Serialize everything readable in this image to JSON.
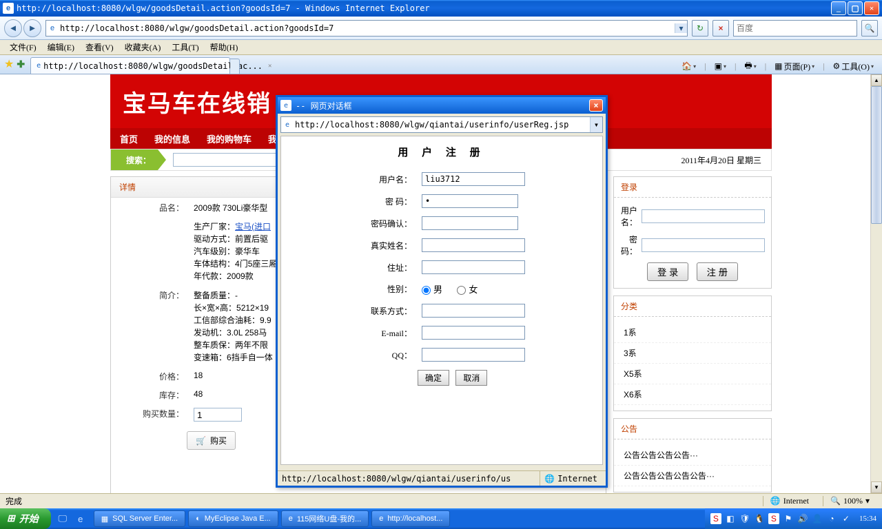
{
  "titlebar": {
    "text": "http://localhost:8080/wlgw/goodsDetail.action?goodsId=7 - Windows Internet Explorer"
  },
  "address": "http://localhost:8080/wlgw/goodsDetail.action?goodsId=7",
  "search_placeholder": "百度",
  "menu": {
    "file": "文件(F)",
    "edit": "编辑(E)",
    "view": "查看(V)",
    "fav": "收藏夹(A)",
    "tools": "工具(T)",
    "help": "帮助(H)"
  },
  "tab_title": "http://localhost:8080/wlgw/goodsDetail.ac...",
  "cmdbar": {
    "page": "页面(P)",
    "tools": "工具(O)"
  },
  "site": {
    "banner": "宝马车在线销",
    "nav": {
      "home": "首页",
      "info": "我的信息",
      "cart": "我的购物车",
      "mine": "我的"
    },
    "search_label": "搜索：",
    "date": "2011年4月20日 星期三",
    "detail_hdr": "详情",
    "labels": {
      "name": "品名：",
      "intro": "简介：",
      "price": "价格：",
      "stock": "库存：",
      "qty": "购买数量："
    },
    "name_value": "2009款 730Li豪华型",
    "spec": {
      "mfr_lbl": "生产厂家：",
      "mfr_val": "宝马(进口",
      "drive_lbl": "驱动方式：",
      "drive_val": "前置后驱",
      "class_lbl": "汽车级别：",
      "class_val": "豪华车",
      "body_lbl": "车体结构：",
      "body_val": "4门5座三厢",
      "year_lbl": "年代款：",
      "year_val": "2009款",
      "mass_lbl": "整备质量：",
      "mass_val": "-",
      "dim_lbl": "长×宽×高：",
      "dim_val": "5212×19",
      "fuel_lbl": "工信部综合油耗：",
      "fuel_val": "9.9",
      "engine_lbl": "发动机：",
      "engine_val": "3.0L 258马",
      "warranty_lbl": "整车质保：",
      "warranty_val": "两年不限",
      "gearbox_lbl": "变速箱：",
      "gearbox_val": "6挡手自一体"
    },
    "price": "18",
    "stock": "48",
    "qty": "1",
    "buy": "购买",
    "login": {
      "hdr": "登录",
      "user": "用户名：",
      "pass": "密  码：",
      "login_btn": "登 录",
      "reg_btn": "注 册"
    },
    "cat": {
      "hdr": "分类",
      "c1": "1系",
      "c3": "3系",
      "x5": "X5系",
      "x6": "X6系"
    },
    "notice": {
      "hdr": "公告",
      "n1": "公告公告公告公告···",
      "n2": "公告公告公告公告公告···"
    }
  },
  "dialog": {
    "title": " -- 网页对话框",
    "url": "http://localhost:8080/wlgw/qiantai/userinfo/userReg.jsp",
    "heading": "用 户 注 册",
    "labels": {
      "user": "用户名：",
      "pass": "密  码：",
      "confirm": "密码确认：",
      "realname": "真实姓名：",
      "addr": "住址：",
      "gender": "性别：",
      "contact": "联系方式：",
      "email": "E-mail：",
      "qq": "QQ："
    },
    "user_value": "liu3712",
    "pass_value": "•",
    "gender_m": "男",
    "gender_f": "女",
    "ok": "确定",
    "cancel": "取消",
    "status_url": "http://localhost:8080/wlgw/qiantai/userinfo/us",
    "zone": "Internet"
  },
  "ie_status": {
    "done": "完成",
    "zone": "Internet",
    "zoom": "100%"
  },
  "taskbar": {
    "start": "开始",
    "t1": "SQL Server Enter...",
    "t2": "MyEclipse Java E...",
    "t3": "115网络U盘-我的...",
    "t4": "http://localhost...",
    "clock": "15:34"
  }
}
